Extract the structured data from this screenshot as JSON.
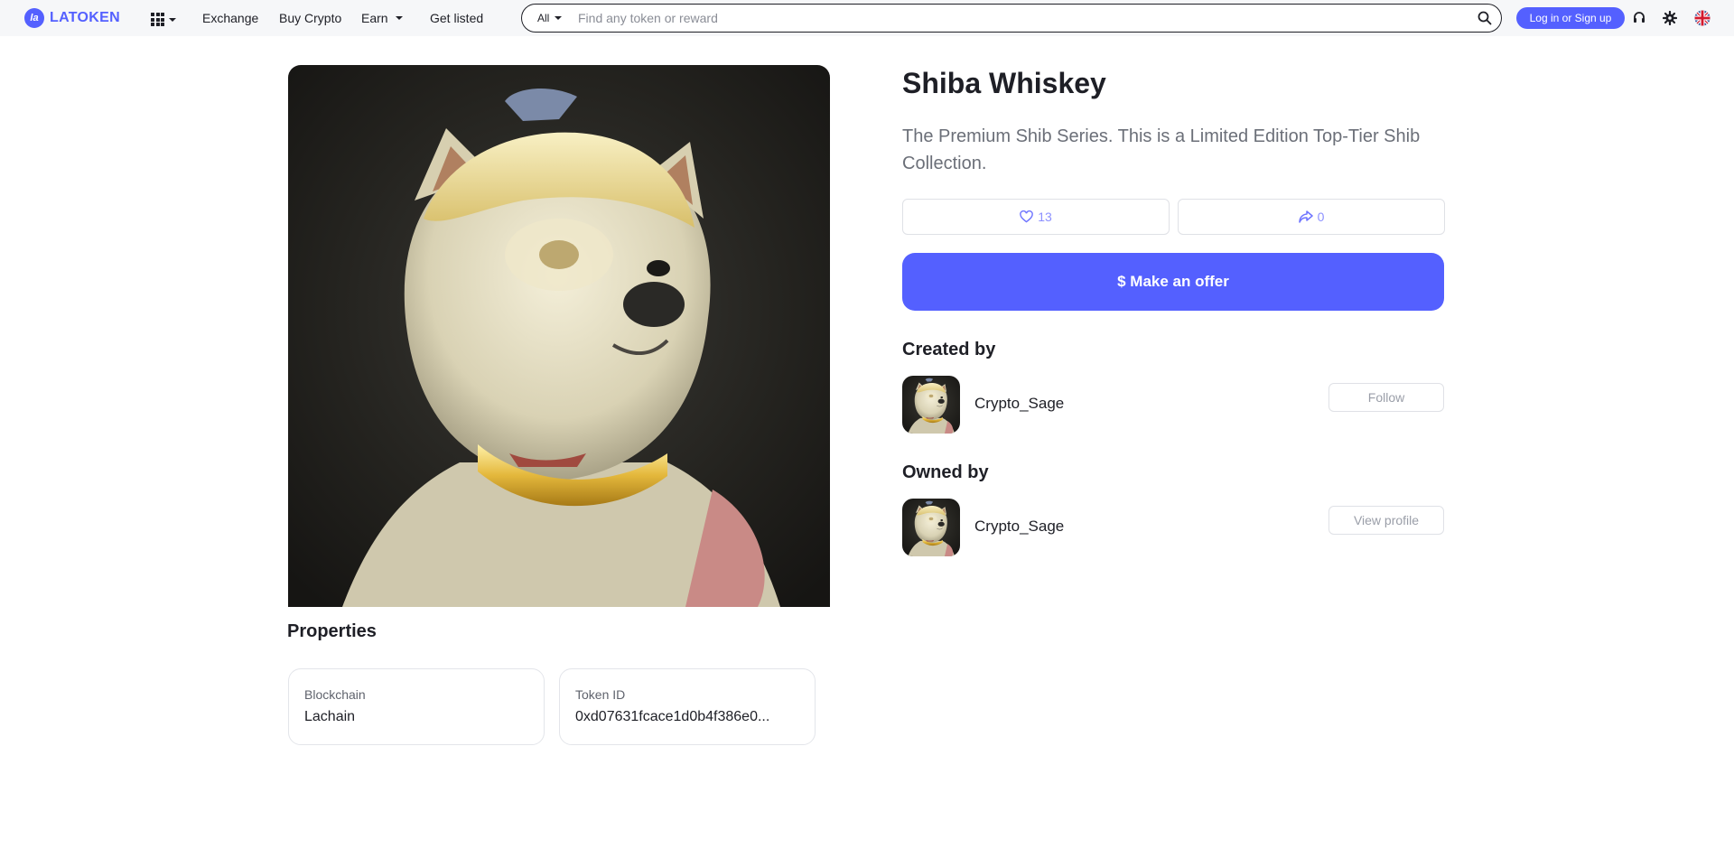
{
  "nav": {
    "brand": "LATOKEN",
    "brand_mark": "la",
    "apps_icon": "grid-icon",
    "links": [
      "Exchange",
      "Buy Crypto",
      "Earn",
      "Get listed"
    ],
    "search": {
      "category": "All",
      "placeholder": "Find any token or reward"
    },
    "login_label": "Log in or Sign up",
    "icons": [
      "support-icon",
      "settings-icon",
      "uk-flag-icon"
    ],
    "accent_color": "#5460ff"
  },
  "nft": {
    "title": "Shiba Whiskey",
    "description": "The Premium Shib Series. This is a Limited Edition Top-Tier Shib Collection.",
    "likes": "13",
    "shares": "0",
    "offer_label": "$ Make an offer"
  },
  "properties": {
    "title": "Properties",
    "items": [
      {
        "label": "Blockchain",
        "value": "Lachain"
      },
      {
        "label": "Token ID",
        "value": "0xd07631fcace1d0b4f386e0..."
      }
    ]
  },
  "created": {
    "title": "Created by",
    "user": "Crypto_Sage",
    "action": "Follow"
  },
  "owned": {
    "title": "Owned by",
    "user": "Crypto_Sage",
    "action": "View profile"
  }
}
